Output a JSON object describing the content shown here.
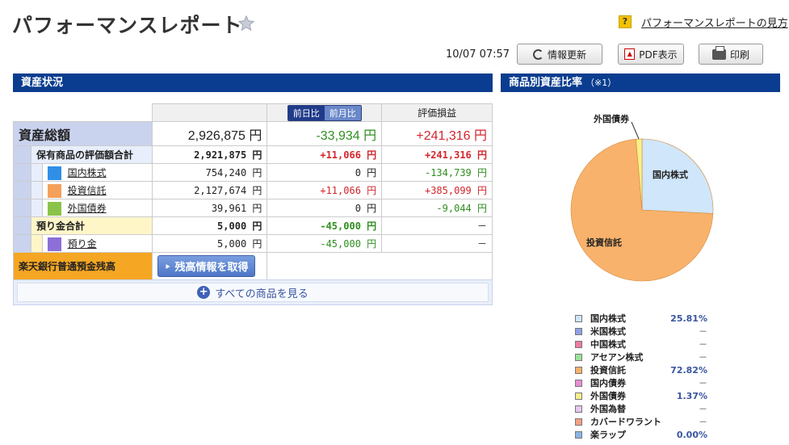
{
  "header": {
    "title": "パフォーマンスレポート",
    "help_link": "パフォーマンスレポートの見方",
    "timestamp": "10/07 07:57"
  },
  "toolbar": {
    "refresh_label": "情報更新",
    "pdf_label": "PDF表示",
    "print_label": "印刷"
  },
  "asset_section": {
    "title": "資産状況",
    "tab_day": "前日比",
    "tab_month": "前月比",
    "col_valuation": "評価損益",
    "total": {
      "label": "資産総額",
      "amount": "2,926,875 円",
      "change": "-33,934 円",
      "pl": "+241,316 円"
    },
    "holdings": {
      "label": "保有商品の評価額合計",
      "amount": "2,921,875 円",
      "change": "+11,066 円",
      "pl": "+241,316 円"
    },
    "items": [
      {
        "label": "国内株式",
        "amount": "754,240 円",
        "change": "0 円",
        "pl": "-134,739 円",
        "color": "#2f8fe6"
      },
      {
        "label": "投資信託",
        "amount": "2,127,674 円",
        "change": "+11,066 円",
        "pl": "+385,099 円",
        "color": "#f5a05a"
      },
      {
        "label": "外国債券",
        "amount": "39,961 円",
        "change": "0 円",
        "pl": "-9,044 円",
        "color": "#8bc34a"
      }
    ],
    "deposit": {
      "label": "預り金合計",
      "amount": "5,000 円",
      "change": "-45,000 円",
      "pl": "－"
    },
    "deposit_item": {
      "label": "預り金",
      "amount": "5,000 円",
      "change": "-45,000 円",
      "pl": "－",
      "color": "#8c6fd8"
    },
    "bank": {
      "label": "楽天銀行普通預金残高",
      "button": "残高情報を取得"
    },
    "see_all": "すべての商品を見る"
  },
  "ratio_section": {
    "title": "商品別資産比率",
    "note": "（※1）",
    "pie_labels": {
      "a": "外国債券",
      "b": "国内株式",
      "c": "投資信託"
    }
  },
  "chart_data": {
    "type": "pie",
    "title": "商品別資産比率",
    "slices": [
      {
        "name": "国内株式",
        "value": 25.81,
        "color": "#cfe6fb"
      },
      {
        "name": "投資信託",
        "value": 72.82,
        "color": "#f9b26b"
      },
      {
        "name": "外国債券",
        "value": 1.37,
        "color": "#f7f08a"
      }
    ]
  },
  "legend": [
    {
      "name": "国内株式",
      "value": "25.81%",
      "color": "#cfe6fb"
    },
    {
      "name": "米国株式",
      "value": "－",
      "color": "#8fa2e6"
    },
    {
      "name": "中国株式",
      "value": "－",
      "color": "#f07aa0"
    },
    {
      "name": "アセアン株式",
      "value": "－",
      "color": "#9be39b"
    },
    {
      "name": "投資信託",
      "value": "72.82%",
      "color": "#f9b26b"
    },
    {
      "name": "国内債券",
      "value": "－",
      "color": "#e88ed8"
    },
    {
      "name": "外国債券",
      "value": "1.37%",
      "color": "#f7f08a"
    },
    {
      "name": "外国為替",
      "value": "－",
      "color": "#e5c8f0"
    },
    {
      "name": "カバードワラント",
      "value": "－",
      "color": "#f5a080"
    },
    {
      "name": "楽ラップ",
      "value": "0.00%",
      "color": "#8ab4e6"
    }
  ]
}
